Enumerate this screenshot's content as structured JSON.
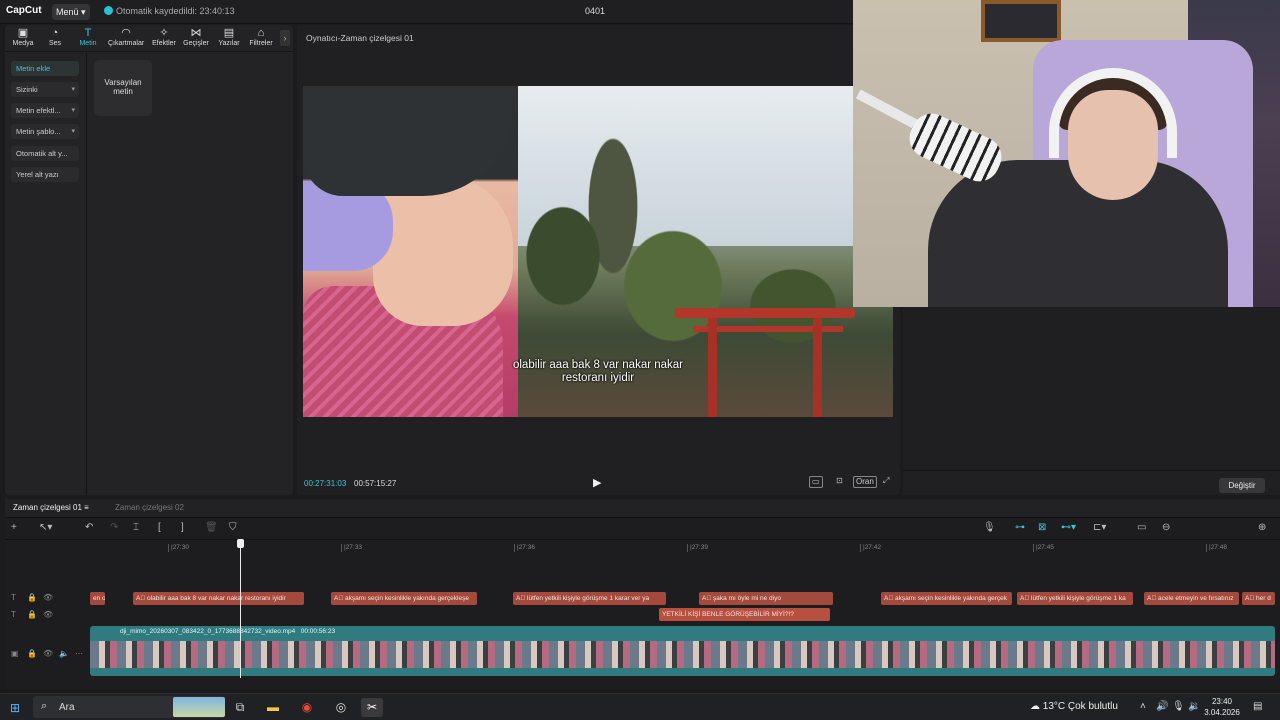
{
  "titlebar": {
    "logo": "CapCut",
    "menu_label": "Menü",
    "autosave": "Otomatik kaydedildi: 23:40:13",
    "project_title": "0401"
  },
  "tools": [
    {
      "label": "Medya",
      "icon": "media-icon"
    },
    {
      "label": "Ses",
      "icon": "audio-icon"
    },
    {
      "label": "Metin",
      "icon": "text-icon"
    },
    {
      "label": "Çıkartmalar",
      "icon": "sticker-icon"
    },
    {
      "label": "Efektler",
      "icon": "effects-icon"
    },
    {
      "label": "Geçişler",
      "icon": "transitions-icon"
    },
    {
      "label": "Yazılar",
      "icon": "captions-icon"
    },
    {
      "label": "Filtreler",
      "icon": "filters-icon"
    }
  ],
  "side_items": [
    {
      "label": "Metin ekle"
    },
    {
      "label": "Sizinki"
    },
    {
      "label": "Metin efektl..."
    },
    {
      "label": "Metin şablo..."
    },
    {
      "label": "Otomatik alt y..."
    },
    {
      "label": "Yerel alt yazı"
    }
  ],
  "preset_card": "Varsayılan metin",
  "player": {
    "title": "Oynatıcı-Zaman çizelgesi 01",
    "subtitle_line1": "olabilir aaa bak 8 var nakar nakar",
    "subtitle_line2": "restoranı iyidir",
    "current_time": "00:27:31:03",
    "total_time": "00:57:15:27",
    "ratio_label": "Oran"
  },
  "right_panel": {
    "change_button": "Değiştir"
  },
  "timeline": {
    "tab_active": "Zaman çizelgesi 01",
    "tab_inactive": "Zaman çizelgesi 02",
    "ruler_ticks": [
      "|27:30",
      "|27:33",
      "|27:36",
      "|27:39",
      "|27:42",
      "|27:45",
      "|27:48"
    ],
    "text_clips": [
      "en o",
      "olabilir aaa bak 8 var nakar nakar restoranı iyidir",
      "akşamı seçin kesinlikle yakında gerçekleşe",
      "lütfen yetkili kişiyle görüşme 1 karar ver ya",
      "şaka mı öyle mi ne diyo",
      "akşamı seçin kesinlikle yakında gerçek",
      "lütfen yetkili kişiyle görüşme 1 ka",
      "acele etmeyin ve fırsatınız",
      "her d"
    ],
    "text_clip_2": "YETKİLİ KİŞİ BENLE GÖRÜŞEBİLİR MİYİ?!?",
    "video_clip": "dji_mimo_20260307_083422_0_1773688842732_video.mp4",
    "video_duration": "00:00:56:23"
  },
  "taskbar": {
    "search_placeholder": "Ara",
    "weather": "13°C  Çok bulutlu",
    "time": "23:40",
    "date": "3.04.2026"
  }
}
